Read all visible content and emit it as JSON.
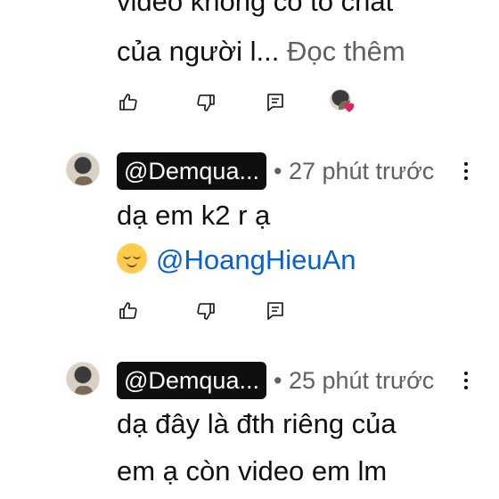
{
  "top_comment": {
    "line1": "video không có tố chất",
    "line2": "của người l...",
    "read_more": "Đọc thêm",
    "actions": {
      "like_icon": "thumbs-up-icon",
      "dislike_icon": "thumbs-down-icon",
      "reply_icon": "reply-icon"
    }
  },
  "comments": [
    {
      "handle": "@Demqua...",
      "time": "• 27 phút trước",
      "line1": "dạ em k2 r ạ",
      "emoji": "relieved-face",
      "mention": "@HoangHieuAn"
    },
    {
      "handle": "@Demqua...",
      "time": "• 25 phút trước",
      "line1": "dạ đây là đth riêng của",
      "line2": "em ạ còn video em lm"
    }
  ],
  "colors": {
    "text": "#0f0f0f",
    "muted": "#606060",
    "link": "#065fd4",
    "heart": "#e0245e"
  }
}
